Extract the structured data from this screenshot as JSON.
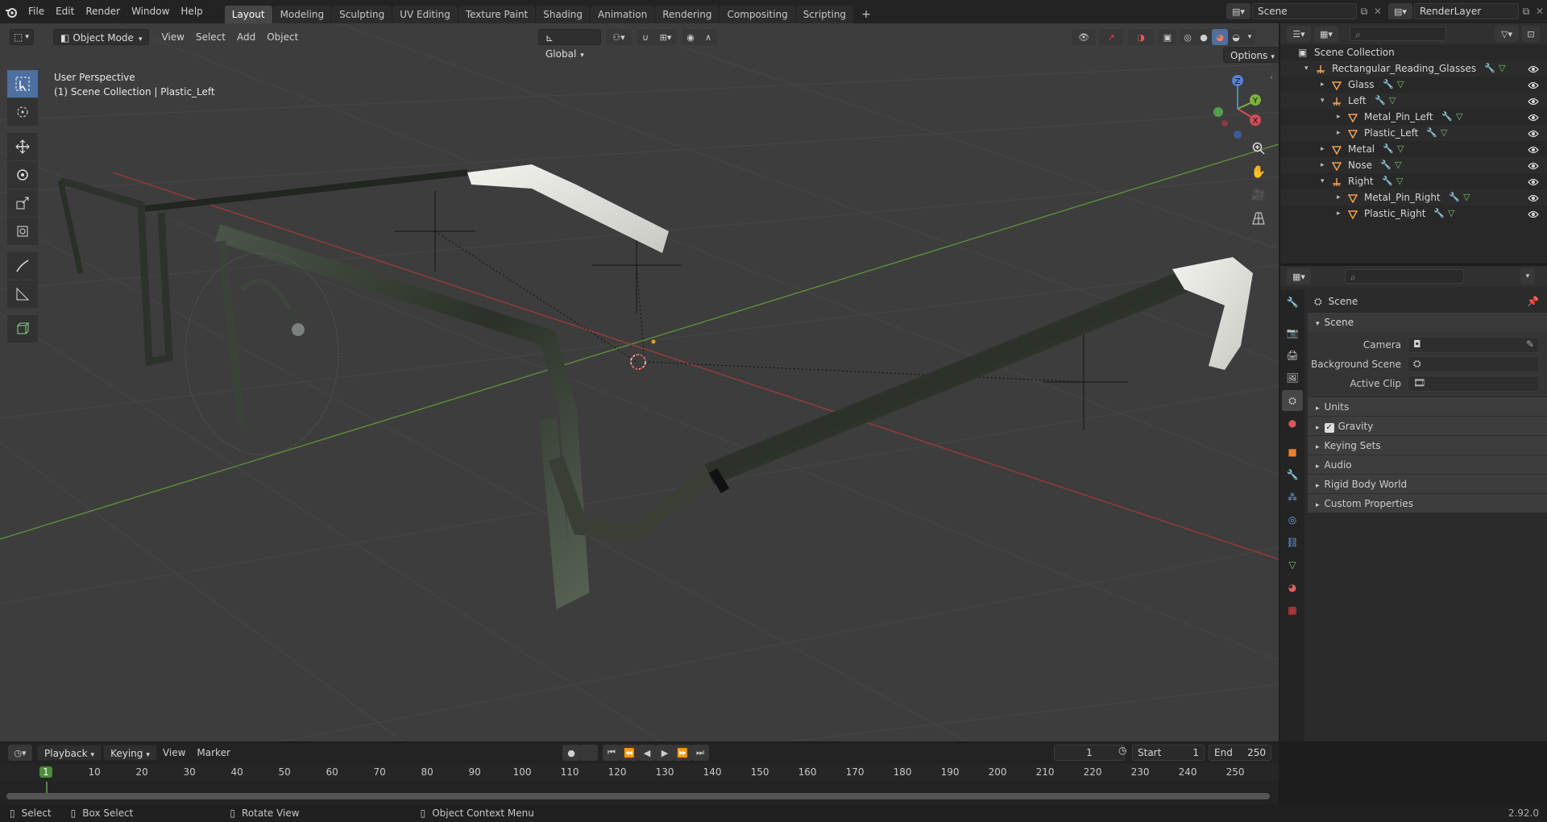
{
  "topbar": {
    "menus": [
      "File",
      "Edit",
      "Render",
      "Window",
      "Help"
    ],
    "workspaces": [
      "Layout",
      "Modeling",
      "Sculpting",
      "UV Editing",
      "Texture Paint",
      "Shading",
      "Animation",
      "Rendering",
      "Compositing",
      "Scripting"
    ],
    "active_workspace": "Layout",
    "add_tab": "+",
    "scene_name": "Scene",
    "view_layer": "RenderLayer"
  },
  "viewport": {
    "mode": "Object Mode",
    "menus": [
      "View",
      "Select",
      "Add",
      "Object"
    ],
    "transform_orientation": "Global",
    "options": "Options",
    "info_line1": "User Perspective",
    "info_line2": "(1) Scene Collection | Plastic_Left",
    "gizmo": {
      "x": "X",
      "y": "Y",
      "z": "Z"
    }
  },
  "outliner": {
    "root": "Scene Collection",
    "rows": [
      {
        "label": "Rectangular_Reading_Glasses",
        "depth": 1,
        "type": "empty",
        "expanded": true
      },
      {
        "label": "Glass",
        "depth": 2,
        "type": "mesh",
        "expanded": false
      },
      {
        "label": "Left",
        "depth": 2,
        "type": "empty",
        "expanded": true
      },
      {
        "label": "Metal_Pin_Left",
        "depth": 3,
        "type": "mesh",
        "expanded": false
      },
      {
        "label": "Plastic_Left",
        "depth": 3,
        "type": "mesh",
        "expanded": false
      },
      {
        "label": "Metal",
        "depth": 2,
        "type": "mesh",
        "expanded": false
      },
      {
        "label": "Nose",
        "depth": 2,
        "type": "mesh",
        "expanded": false
      },
      {
        "label": "Right",
        "depth": 2,
        "type": "empty",
        "expanded": true
      },
      {
        "label": "Metal_Pin_Right",
        "depth": 3,
        "type": "mesh",
        "expanded": false
      },
      {
        "label": "Plastic_Right",
        "depth": 3,
        "type": "mesh",
        "expanded": false
      }
    ]
  },
  "properties": {
    "context": "Scene",
    "panel": "Scene",
    "camera_label": "Camera",
    "background_label": "Background Scene",
    "clip_label": "Active Clip",
    "subpanels": [
      "Units",
      "Gravity",
      "Keying Sets",
      "Audio",
      "Rigid Body World",
      "Custom Properties"
    ],
    "gravity_checked": true
  },
  "timeline": {
    "menus": [
      "Playback",
      "Keying",
      "View",
      "Marker"
    ],
    "current_frame": "1",
    "start_label": "Start",
    "start": "1",
    "end_label": "End",
    "end": "250",
    "ruler": [
      "1",
      "10",
      "20",
      "30",
      "40",
      "50",
      "60",
      "70",
      "80",
      "90",
      "100",
      "110",
      "120",
      "130",
      "140",
      "150",
      "160",
      "170",
      "180",
      "190",
      "200",
      "210",
      "220",
      "230",
      "240",
      "250"
    ]
  },
  "statusbar": {
    "select": "Select",
    "box_select": "Box Select",
    "rotate": "Rotate View",
    "context_menu": "Object Context Menu",
    "version": "2.92.0"
  }
}
